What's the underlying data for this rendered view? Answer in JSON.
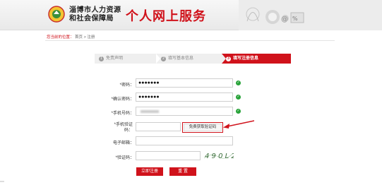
{
  "header": {
    "org_line1": "淄博市人力资源",
    "org_line2": "和社会保障局",
    "service_title": "个人网上服务"
  },
  "breadcrumb": {
    "here": "您当前的位置：",
    "items": [
      "首页",
      "注册"
    ],
    "separator": ">"
  },
  "steps": [
    {
      "num": "1",
      "label": "免责声明"
    },
    {
      "num": "2",
      "label": "填写基本信息"
    },
    {
      "num": "3",
      "label": "填写注册信息"
    }
  ],
  "form": {
    "password_label": "*密码：",
    "password_value": "●●●●●●●",
    "confirm_label": "*确认密码：",
    "confirm_value": "●●●●●●●",
    "phone_label": "*手机号码：",
    "sms_label_1": "*手机验证",
    "sms_label_2": "码：",
    "get_code_button": "免费获取验证码",
    "email_label": "电子邮箱：",
    "captcha_label": "*验证码：",
    "captcha_text": "4 9 0 L 2"
  },
  "buttons": {
    "register": "立即注册",
    "reset": "重 置"
  },
  "colors": {
    "accent": "#d0121b",
    "success": "#29a33a"
  }
}
